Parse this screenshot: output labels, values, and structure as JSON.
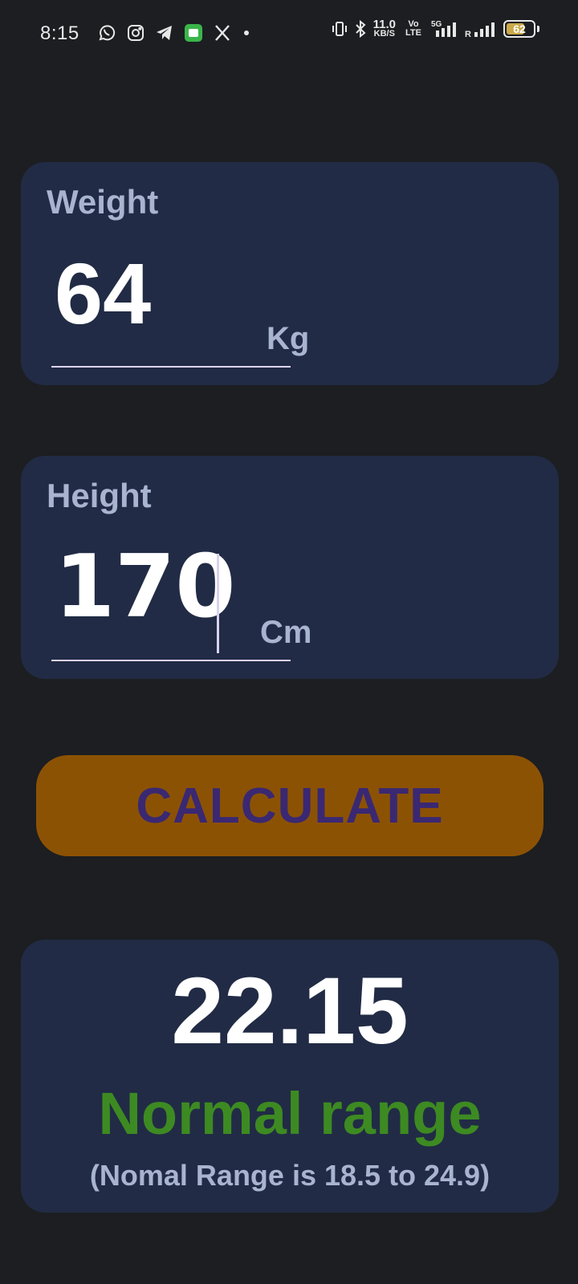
{
  "status_bar": {
    "time": "8:15",
    "net_speed": "11.0",
    "net_speed_unit": "KB/S",
    "volte_top": "Vo LTE",
    "network": "5G",
    "roaming": "R",
    "battery": "62",
    "notification_icons": [
      "whatsapp-icon",
      "instagram-icon",
      "telegram-icon",
      "app-icon",
      "x-icon",
      "more-dot-icon"
    ],
    "system_icons": [
      "vibrate-icon",
      "bluetooth-icon",
      "signal-icon",
      "signal-roaming-icon",
      "battery-icon"
    ]
  },
  "weight": {
    "label": "Weight",
    "value": "64",
    "unit": "Kg"
  },
  "height": {
    "label": "Height",
    "value": "170",
    "unit": "Cm"
  },
  "calculate_button": {
    "label": "CALCULATE"
  },
  "result": {
    "bmi": "22.15",
    "category": "Normal range",
    "note": "(Nomal Range is 18.5 to 24.9)"
  },
  "colors": {
    "background": "#1c1e21",
    "card": "#212b45",
    "label": "#a8b4d0",
    "button": "#8c5204",
    "button_text": "#3a2872",
    "category": "#3d8a22"
  }
}
